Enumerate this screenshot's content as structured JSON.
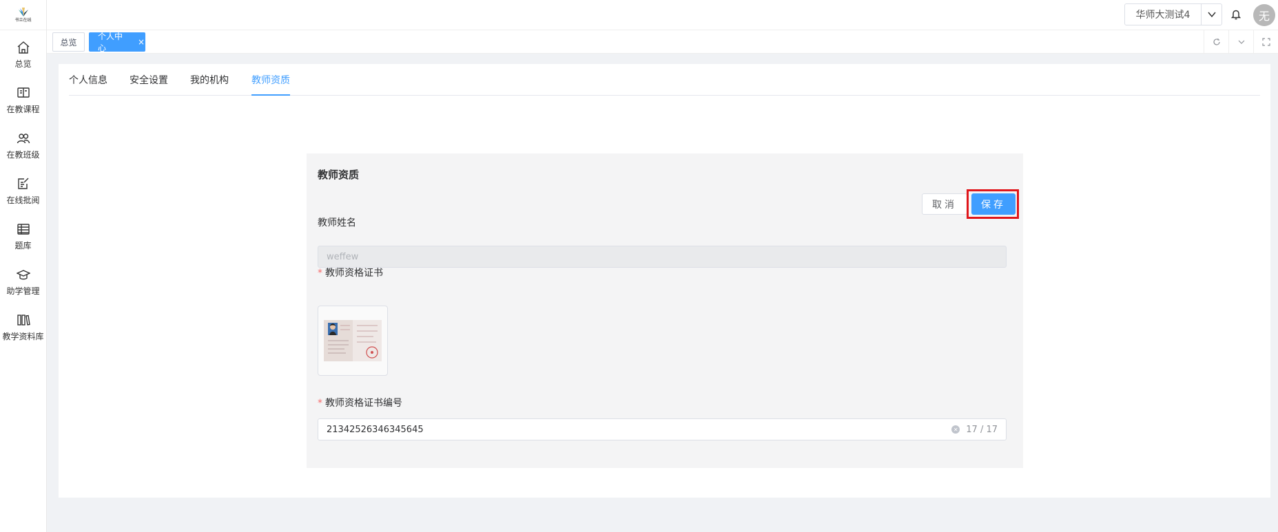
{
  "logo": {
    "text": "书兰在线"
  },
  "sidebar": {
    "items": [
      {
        "label": "总览",
        "icon": "home-icon"
      },
      {
        "label": "在教课程",
        "icon": "book-icon"
      },
      {
        "label": "在教班级",
        "icon": "users-icon"
      },
      {
        "label": "在线批阅",
        "icon": "edit-icon"
      },
      {
        "label": "题库",
        "icon": "question-bank-icon"
      },
      {
        "label": "助学管理",
        "icon": "graduation-cap-icon"
      },
      {
        "label": "教学资料库",
        "icon": "library-icon"
      }
    ]
  },
  "header": {
    "org_name": "华师大测试4",
    "avatar_text": "无"
  },
  "tabbar": {
    "tabs": [
      {
        "label": "总览"
      },
      {
        "label": "个人中心",
        "close": "×"
      }
    ]
  },
  "profile_tabs": [
    {
      "label": "个人信息"
    },
    {
      "label": "安全设置"
    },
    {
      "label": "我的机构"
    },
    {
      "label": "教师资质",
      "active": true
    }
  ],
  "form": {
    "title": "教师资质",
    "cancel_label": "取消",
    "save_label": "保存",
    "name_label": "教师姓名",
    "name_value": "weffew",
    "cert_label": "教师资格证书",
    "required_mark": "*",
    "cert_no_label": "教师资格证书编号",
    "cert_no_value": "21342526346345645",
    "cert_no_count": "17 / 17"
  },
  "colors": {
    "primary": "#409eff",
    "highlight": "#e0161b",
    "required": "#f56c6c"
  }
}
